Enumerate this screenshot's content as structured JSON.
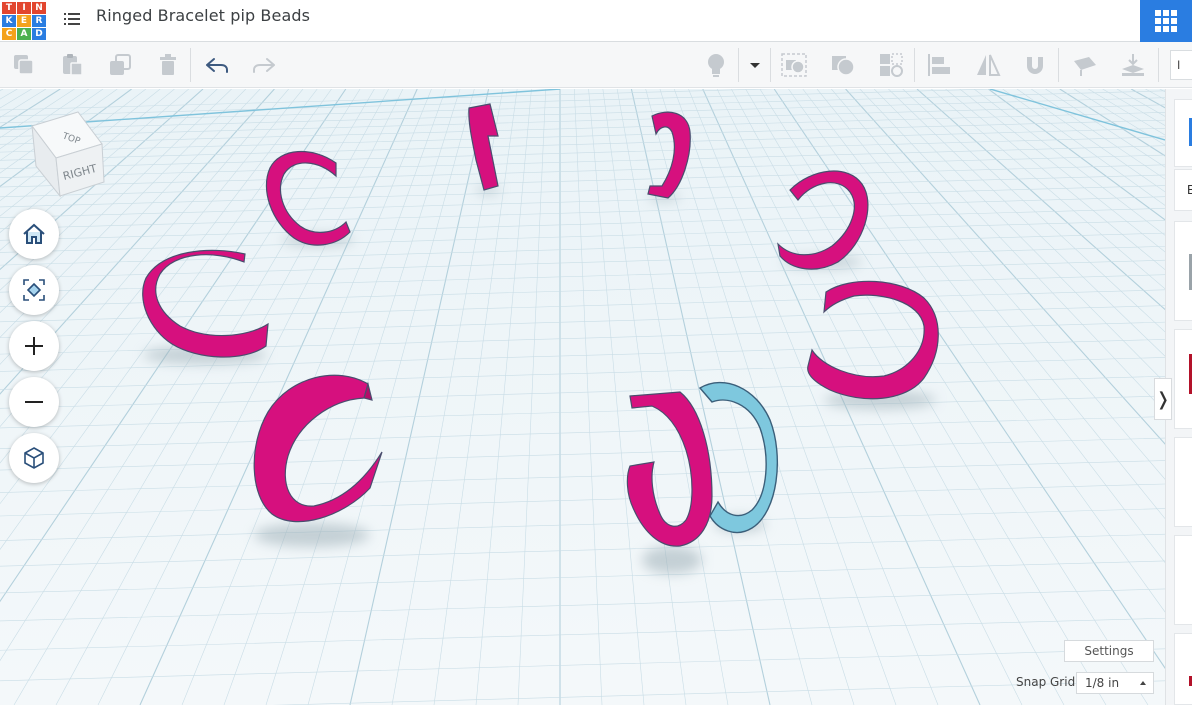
{
  "header": {
    "logo_letters": [
      "T",
      "I",
      "N",
      "K",
      "E",
      "R",
      "C",
      "A",
      "D"
    ],
    "logo_colors": [
      "#e2462f",
      "#e2462f",
      "#e2462f",
      "#2a7de1",
      "#f4a21c",
      "#2a7de1",
      "#f4a21c",
      "#4bb04f",
      "#2a7de1"
    ],
    "doc_title": "Ringed Bracelet pip Beads",
    "menu_icon": "list-icon",
    "apps_icon": "grid-icon",
    "accent": "#2a7de1"
  },
  "toolbar": {
    "left_icons": [
      "copy-icon",
      "paste-icon",
      "duplicate-icon",
      "delete-icon",
      "undo-icon",
      "redo-icon"
    ],
    "right_icons": [
      "light-bulb-icon",
      "dropdown-caret-icon",
      "group-icon",
      "ungroup-icon",
      "hole-solid-icon",
      "align-icon",
      "mirror-icon",
      "magnet-icon",
      "workplane-icon",
      "ruler-drop-icon"
    ],
    "import_label": "I"
  },
  "view_cube": {
    "top_label": "TOP",
    "right_label": "RIGHT"
  },
  "nav_controls": [
    "home-icon",
    "fit-view-icon",
    "zoom-in-icon",
    "zoom-out-icon",
    "perspective-icon"
  ],
  "scene": {
    "shape_color": "#d6107e",
    "selected_color": "#7ec8de",
    "grid_color": "#c9dde6"
  },
  "right_panel": {
    "toggle_label": "❭",
    "partial_label": "B"
  },
  "footer": {
    "settings_label": "Settings",
    "snap_label": "Snap Grid",
    "snap_value": "1/8 in"
  }
}
